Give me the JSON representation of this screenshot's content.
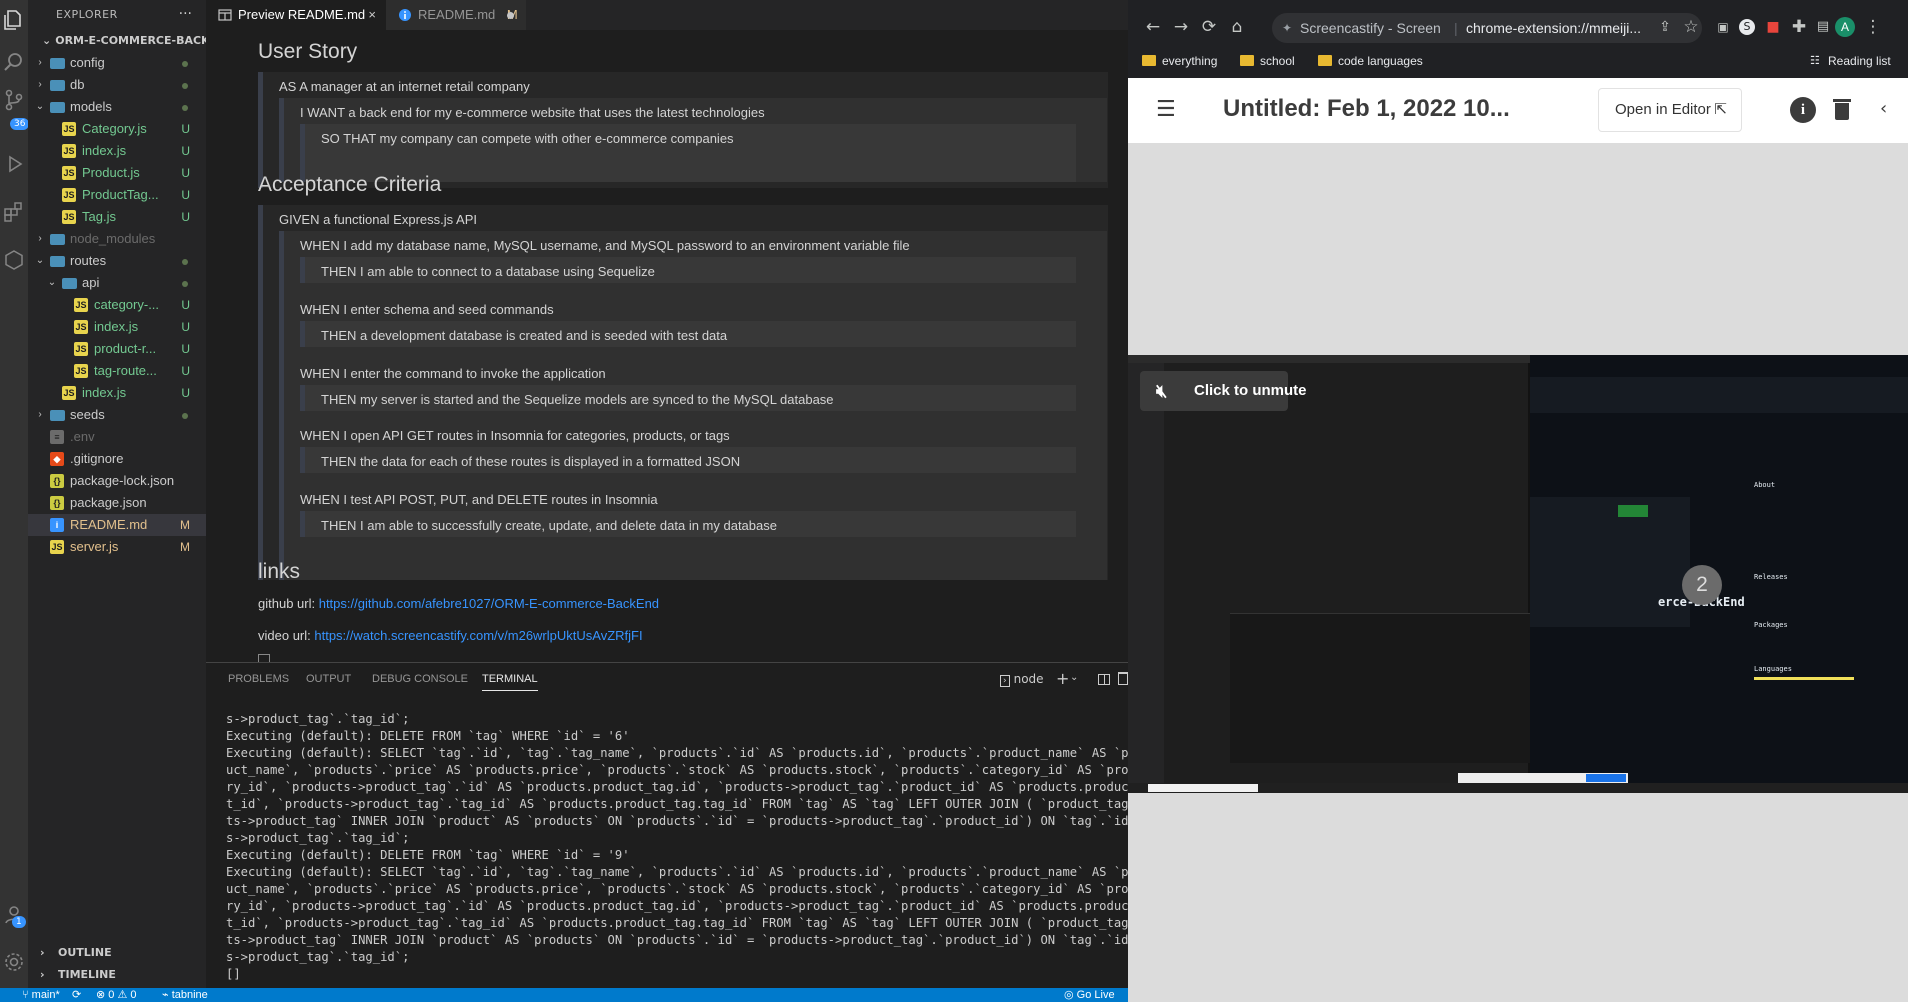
{
  "vscode": {
    "explorer_label": "EXPLORER",
    "project": "ORM-E-COMMERCE-BACK...",
    "tree": [
      {
        "name": "config",
        "kind": "folder",
        "depth": 1,
        "open": false,
        "status": "dot"
      },
      {
        "name": "db",
        "kind": "folder",
        "depth": 1,
        "open": false,
        "status": "dot"
      },
      {
        "name": "models",
        "kind": "folder",
        "depth": 1,
        "open": true,
        "status": "dot"
      },
      {
        "name": "Category.js",
        "kind": "js",
        "depth": 2,
        "status": "U"
      },
      {
        "name": "index.js",
        "kind": "js",
        "depth": 2,
        "status": "U"
      },
      {
        "name": "Product.js",
        "kind": "js",
        "depth": 2,
        "status": "U"
      },
      {
        "name": "ProductTag...",
        "kind": "js",
        "depth": 2,
        "status": "U"
      },
      {
        "name": "Tag.js",
        "kind": "js",
        "depth": 2,
        "status": "U"
      },
      {
        "name": "node_modules",
        "kind": "folder",
        "depth": 1,
        "open": false,
        "status": "",
        "ignored": true
      },
      {
        "name": "routes",
        "kind": "folder",
        "depth": 1,
        "open": true,
        "status": "dot"
      },
      {
        "name": "api",
        "kind": "folder",
        "depth": 2,
        "open": true,
        "status": "dot"
      },
      {
        "name": "category-...",
        "kind": "js",
        "depth": 3,
        "status": "U"
      },
      {
        "name": "index.js",
        "kind": "js",
        "depth": 3,
        "status": "U"
      },
      {
        "name": "product-r...",
        "kind": "js",
        "depth": 3,
        "status": "U"
      },
      {
        "name": "tag-route...",
        "kind": "js",
        "depth": 3,
        "status": "U"
      },
      {
        "name": "index.js",
        "kind": "js",
        "depth": 2,
        "status": "U"
      },
      {
        "name": "seeds",
        "kind": "folder",
        "depth": 1,
        "open": false,
        "status": "dot"
      },
      {
        "name": ".env",
        "kind": "env",
        "depth": 1,
        "status": "",
        "ignored": true
      },
      {
        "name": ".gitignore",
        "kind": "git",
        "depth": 1,
        "status": ""
      },
      {
        "name": "package-lock.json",
        "kind": "json",
        "depth": 1,
        "status": ""
      },
      {
        "name": "package.json",
        "kind": "json",
        "depth": 1,
        "status": ""
      },
      {
        "name": "README.md",
        "kind": "info",
        "depth": 1,
        "status": "M",
        "selected": true
      },
      {
        "name": "server.js",
        "kind": "js",
        "depth": 1,
        "status": "M"
      }
    ],
    "outline_label": "OUTLINE",
    "timeline_label": "TIMELINE",
    "activity_badge": "36",
    "account_badge": "1",
    "tabs": [
      {
        "label": "Preview README.md",
        "close": "×"
      },
      {
        "label": "README.md",
        "status": "M"
      }
    ],
    "preview": {
      "h_user_story": "User Story",
      "us": [
        "AS A manager at an internet retail company",
        "I WANT a back end for my e-commerce website that uses the latest technologies",
        "SO THAT my company can compete with other e-commerce companies"
      ],
      "h_acceptance": "Acceptance Criteria",
      "ac": [
        "GIVEN a functional Express.js API",
        "WHEN I add my database name, MySQL username, and MySQL password to an environment variable file",
        "THEN I am able to connect to a database using Sequelize",
        "WHEN I enter schema and seed commands",
        "THEN a development database is created and is seeded with test data",
        "WHEN I enter the command to invoke the application",
        "THEN my server is started and the Sequelize models are synced to the MySQL database",
        "WHEN I open API GET routes in Insomnia for categories, products, or tags",
        "THEN the data for each of these routes is displayed in a formatted JSON",
        "WHEN I test API POST, PUT, and DELETE routes in Insomnia",
        "THEN I am able to successfully create, update, and delete data in my database"
      ],
      "h_links": "links",
      "github_label": "github url:",
      "github_url": "https://github.com/afebre1027/ORM-E-commerce-BackEnd",
      "video_label": "video url:",
      "video_url": "https://watch.screencastify.com/v/m26wrlpUktUsAvZRfjFI"
    },
    "panel_tabs": [
      "PROBLEMS",
      "OUTPUT",
      "DEBUG CONSOLE",
      "TERMINAL"
    ],
    "terminal_shell": "node",
    "terminal_lines": [
      "s->product_tag`.`tag_id`;",
      "Executing (default): DELETE FROM `tag` WHERE `id` = '6'",
      "Executing (default): SELECT `tag`.`id`, `tag`.`tag_name`, `products`.`id` AS `products.id`, `products`.`product_name` AS `product",
      "uct_name`, `products`.`price` AS `products.price`, `products`.`stock` AS `products.stock`, `products`.`category_id` AS `products.catego",
      "ry_id`, `products->product_tag`.`id` AS `products.product_tag.id`, `products->product_tag`.`product_id` AS `products.product_tag.",
      "t_id`, `products->product_tag`.`tag_id` AS `products.product_tag.tag_id` FROM `tag` AS `tag` LEFT OUTER JOIN ( `product_tag` AS `",
      "ts->product_tag` INNER JOIN `product` AS `products` ON `products`.`id` = `products->product_tag`.`product_id`) ON `tag`.`id` = `p",
      "s->product_tag`.`tag_id`;",
      "Executing (default): DELETE FROM `tag` WHERE `id` = '9'",
      "Executing (default): SELECT `tag`.`id`, `tag`.`tag_name`, `products`.`id` AS `products.id`, `products`.`product_name` AS `product",
      "uct_name`, `products`.`price` AS `products.price`, `products`.`stock` AS `products.stock`, `products`.`category_id` AS `products.catego",
      "ry_id`, `products->product_tag`.`id` AS `products.product_tag.id`, `products->product_tag`.`product_id` AS `products.product_tag.",
      "t_id`, `products->product_tag`.`tag_id` AS `products.product_tag.tag_id` FROM `tag` AS `tag` LEFT OUTER JOIN ( `product_tag` AS `",
      "ts->product_tag` INNER JOIN `product` AS `products` ON `products`.`id` = `products->product_tag`.`product_id`) ON `tag`.`id` = `p",
      "s->product_tag`.`tag_id`;",
      "[]"
    ],
    "status": {
      "branch": "main*",
      "problems": "⊗ 0 ⚠ 0",
      "tabnine": "tabnine",
      "golive": "Go Live"
    }
  },
  "chrome": {
    "omnibox_title": "Screencastify - Screen",
    "omnibox_url": "chrome-extension://mmeiji...",
    "bookmarks": [
      "everything",
      "school",
      "code languages"
    ],
    "reading_list": "Reading list",
    "avatar_letter": "A",
    "screencastify": {
      "title": "Untitled: Feb 1, 2022 10...",
      "open_editor": "Open in Editor",
      "unmute": "Click to unmute",
      "count": "2",
      "inner_repo": "erce-BackEnd",
      "inner_about": "About",
      "inner_releases": "Releases",
      "inner_packages": "Packages",
      "inner_languages": "Languages"
    }
  },
  "colors": {
    "vscode_bg": "#1e1e1e",
    "sidebar_bg": "#252526",
    "statusbar": "#007acc",
    "link": "#3794ff",
    "untracked": "#73c991",
    "modified": "#e2c08d"
  }
}
